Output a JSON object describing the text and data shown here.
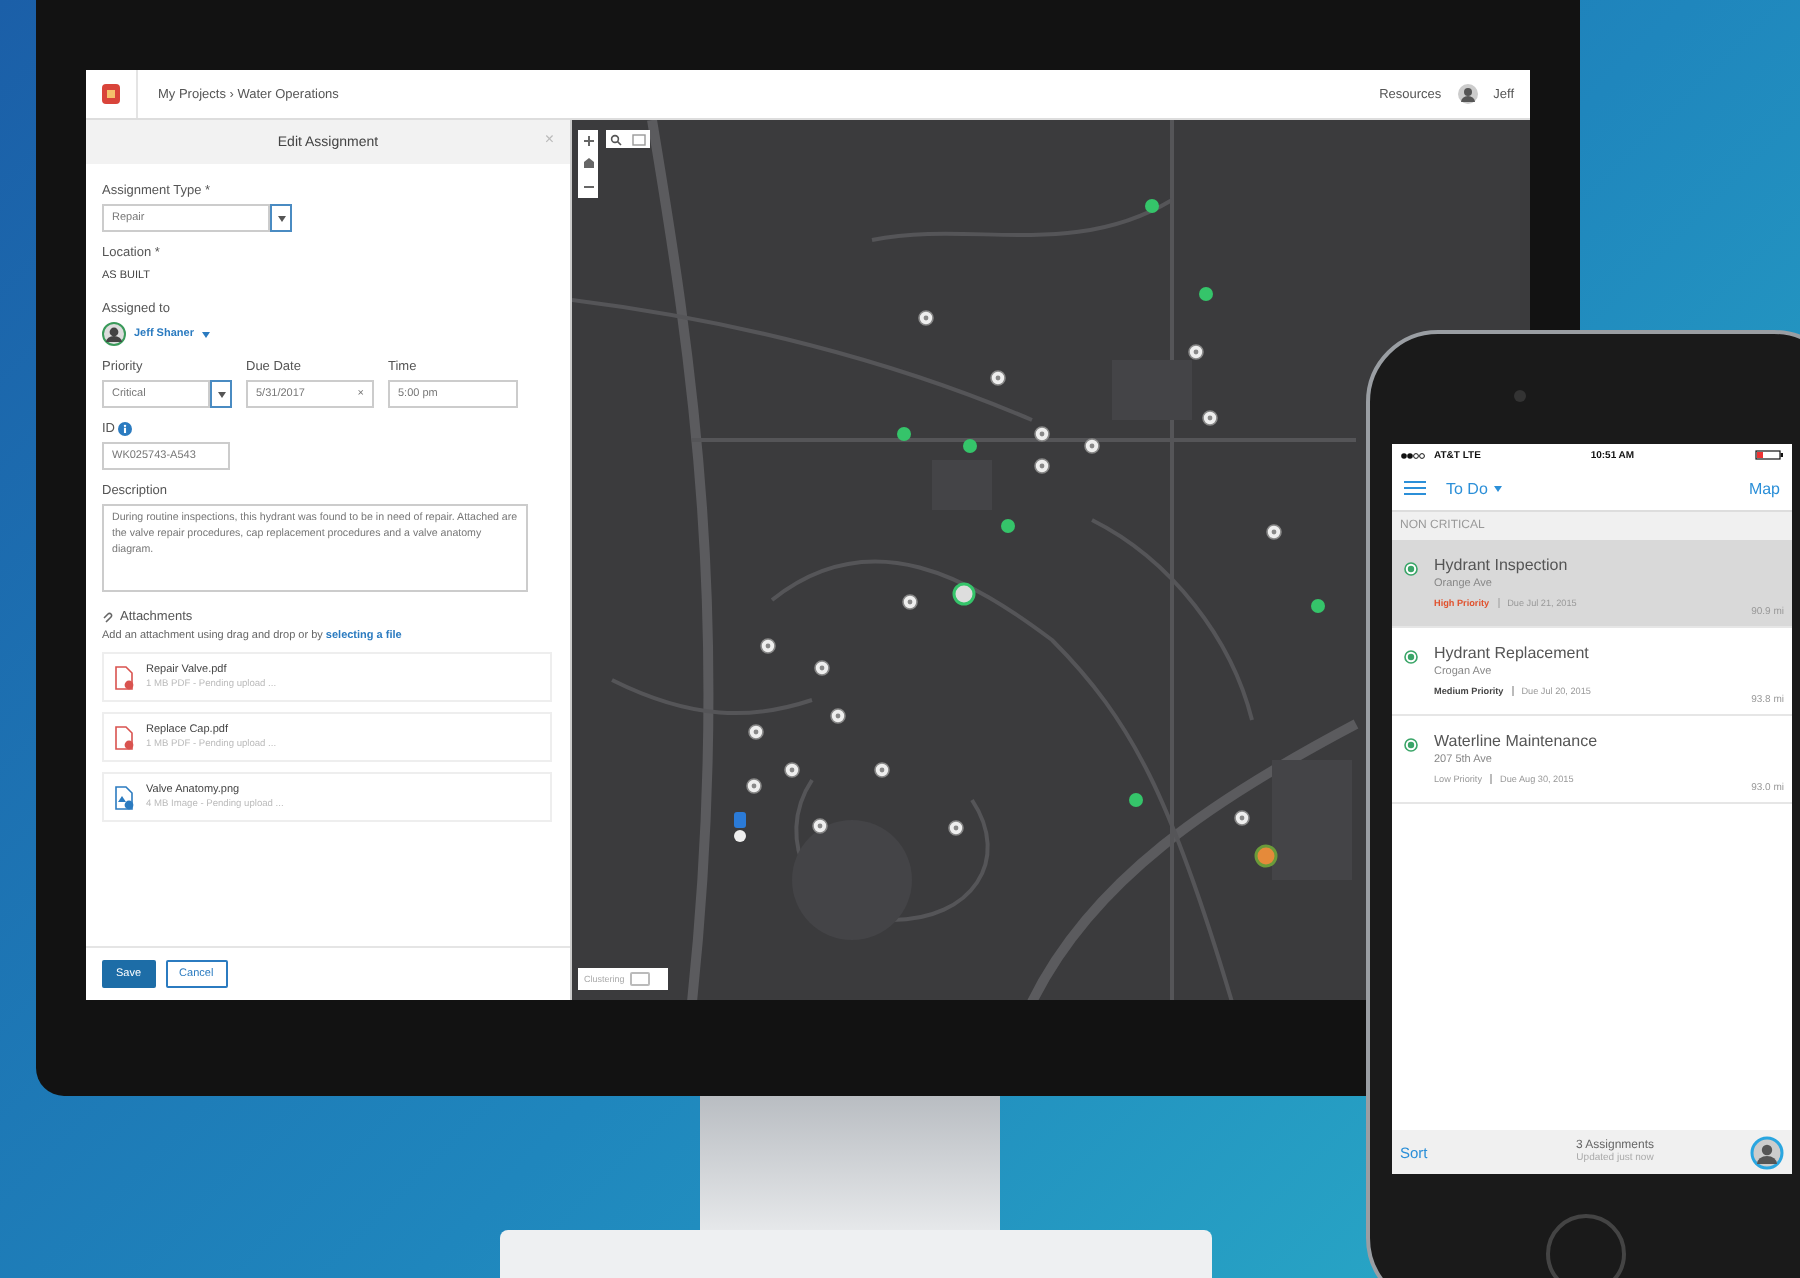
{
  "header": {
    "breadcrumb": "My Projects › Water Operations",
    "resources": "Resources",
    "user": "Jeff"
  },
  "panel": {
    "title": "Edit Assignment",
    "close": "×",
    "assignment_type": {
      "label": "Assignment Type *",
      "value": "Repair"
    },
    "location": {
      "label": "Location *",
      "value": "AS BUILT"
    },
    "assigned_to": {
      "label": "Assigned to",
      "value": "Jeff Shaner"
    },
    "priority": {
      "label": "Priority",
      "value": "Critical"
    },
    "due_date": {
      "label": "Due Date",
      "value": "5/31/2017",
      "clear": "×"
    },
    "time": {
      "label": "Time",
      "value": "5:00 pm"
    },
    "id": {
      "label": "ID",
      "value": "WK025743-A543"
    },
    "description": {
      "label": "Description",
      "value": "During routine inspections, this hydrant was found to be in need of repair. Attached are the valve repair procedures, cap replacement procedures and a valve anatomy diagram."
    },
    "attachments": {
      "label": "Attachments",
      "hint": "Add an attachment using drag and drop or by",
      "link": "selecting a file",
      "files": [
        {
          "kind": "pdf",
          "name": "Repair Valve.pdf",
          "info": "1 MB PDF - Pending upload ..."
        },
        {
          "kind": "pdf",
          "name": "Replace Cap.pdf",
          "info": "1 MB PDF - Pending upload ..."
        },
        {
          "kind": "image",
          "name": "Valve Anatomy.png",
          "info": "4 MB Image - Pending upload ..."
        }
      ]
    },
    "buttons": {
      "save": "Save",
      "cancel": "Cancel"
    }
  },
  "map": {
    "clustering": "Clustering"
  },
  "phone": {
    "carrier": "AT&T  LTE",
    "time": "10:51 AM",
    "list_title": "To Do",
    "map_link": "Map",
    "section": "NON CRITICAL",
    "items": [
      {
        "selected": true,
        "title": "Hydrant Inspection",
        "address": "Orange Ave",
        "kind": "high",
        "priority": "High Priority",
        "due": "Due Jul 21, 2015",
        "distance": "90.9 mi"
      },
      {
        "selected": false,
        "title": "Hydrant Replacement",
        "address": "Crogan Ave",
        "kind": "medium",
        "priority": "Medium Priority",
        "due": "Due Jul 20, 2015",
        "distance": "93.8 mi"
      },
      {
        "selected": false,
        "title": "Waterline Maintenance",
        "address": "207 5th Ave",
        "kind": "low",
        "priority": "Low Priority",
        "due": "Due Aug 30, 2015",
        "distance": "93.0 mi"
      }
    ],
    "sort": "Sort",
    "count": "3 Assignments",
    "updated": "Updated just now"
  }
}
